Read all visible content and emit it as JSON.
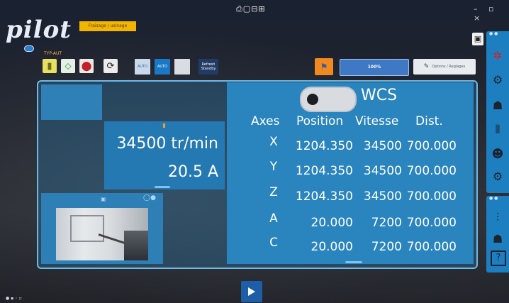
{
  "app": {
    "logo": "pilot",
    "mode_badge": "Fraisage / usinage",
    "machine_label": "TYP-AUT"
  },
  "topbar": {
    "sys_icons": "⎙▢⊟⊞",
    "window_controls": "– ▫ ×"
  },
  "toolbar": {
    "mode_auto1": "AUTO",
    "mode_auto2": "AUTO",
    "mode_refresh": "Refresh Standby",
    "progress_text": "100%",
    "progress_value": 100,
    "options_label": "Options / Reglages"
  },
  "spindle": {
    "speed": "34500 tr/min",
    "current": "20.5 A"
  },
  "wcs": {
    "label": "WCS",
    "enabled": false
  },
  "axes_table": {
    "headers": [
      "Axes",
      "Position",
      "Vitesse",
      "Dist."
    ],
    "rows": [
      {
        "axis": "X",
        "position": "1204.350",
        "speed": "34500",
        "dist": "700.000"
      },
      {
        "axis": "Y",
        "position": "1204.350",
        "speed": "34500",
        "dist": "700.000"
      },
      {
        "axis": "Z",
        "position": "1204.350",
        "speed": "34500",
        "dist": "700.000"
      },
      {
        "axis": "A",
        "position": "20.000",
        "speed": "7200",
        "dist": "700.000"
      },
      {
        "axis": "C",
        "position": "20.000",
        "speed": "7200",
        "dist": "700.000"
      }
    ]
  },
  "sidebar": {
    "icons": [
      "network-icon",
      "tools-icon",
      "operator-icon",
      "tooling-icon",
      "user-icon",
      "settings-icon",
      "sliders-icon",
      "users-icon",
      "help-icon"
    ],
    "help_label": "?"
  },
  "colors": {
    "accent_blue": "#2a84be",
    "panel_border": "#6fb9e6",
    "badge_yellow": "#f2b600",
    "sidebar_blue": "#1d7fc0"
  }
}
